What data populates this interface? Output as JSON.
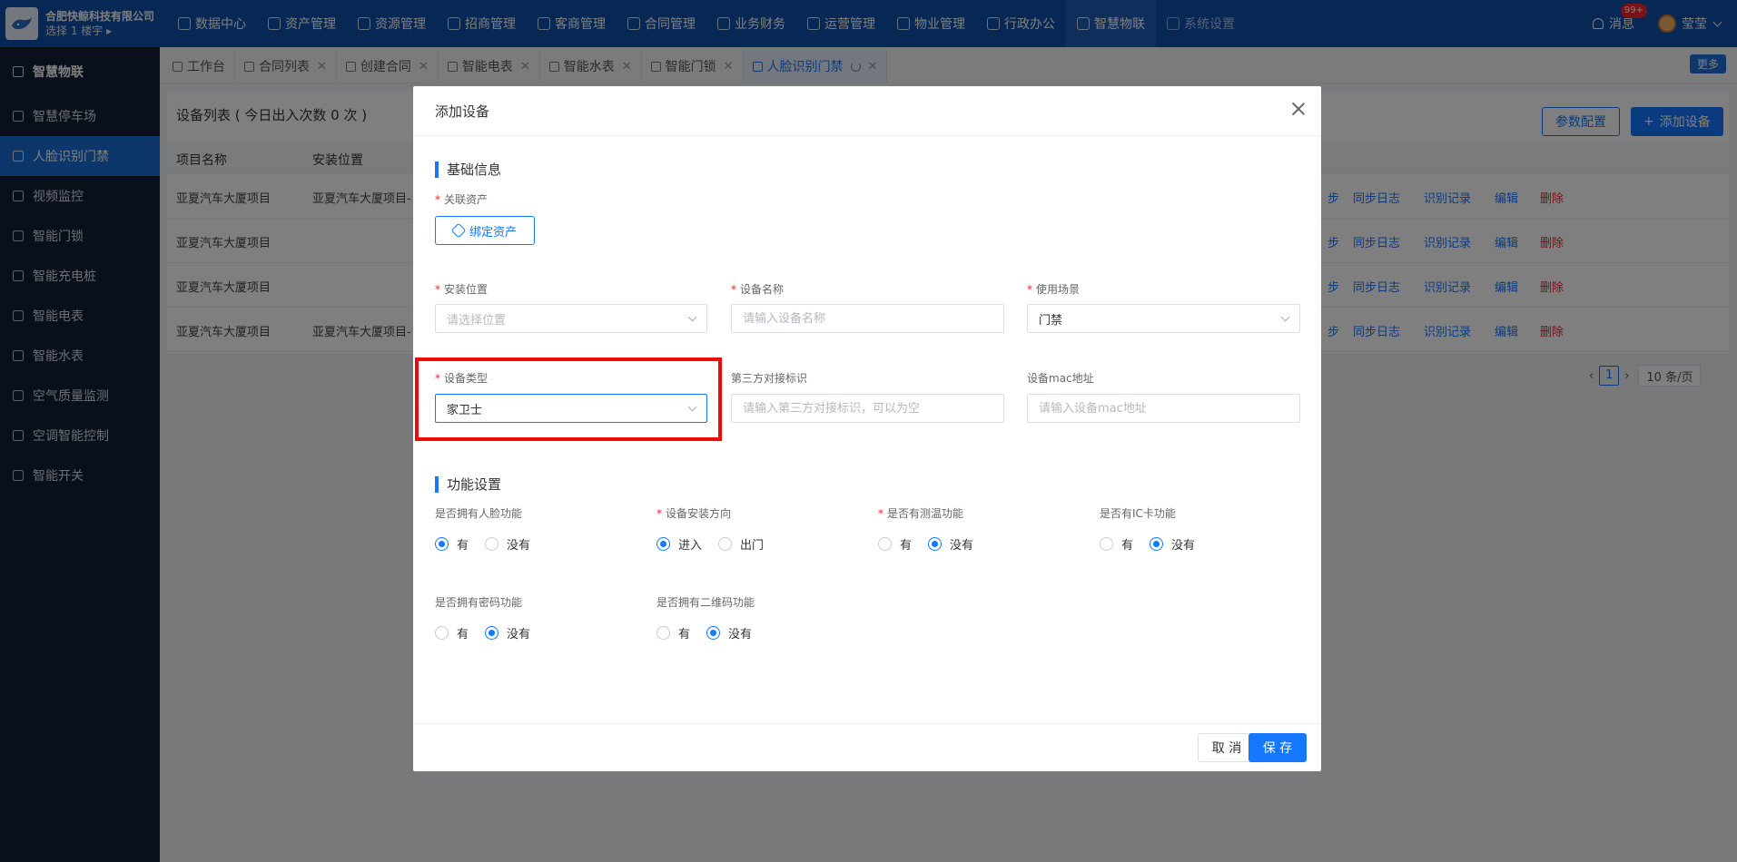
{
  "app": {
    "company": "合肥快鲸科技有限公司",
    "building_select": "选择 1 楼宇 ▸",
    "nav": [
      "数据中心",
      "资产管理",
      "资源管理",
      "招商管理",
      "客商管理",
      "合同管理",
      "业务财务",
      "运营管理",
      "物业管理",
      "行政办公",
      "智慧物联",
      "系统设置"
    ],
    "message_label": "消息",
    "message_badge": "99+",
    "user_name": "莹莹"
  },
  "sidebar": {
    "title": "智慧物联",
    "items": [
      "智慧停车场",
      "人脸识别门禁",
      "视频监控",
      "智能门锁",
      "智能充电桩",
      "智能电表",
      "智能水表",
      "空气质量监测",
      "空调智能控制",
      "智能开关"
    ]
  },
  "tabs": [
    "工作台",
    "合同列表",
    "创建合同",
    "智能电表",
    "智能水表",
    "智能门锁",
    "人脸识别门禁"
  ],
  "more_label": "更多",
  "list": {
    "title": "设备列表 ( 今日出入次数 0 次 )",
    "param_button": "参数配置",
    "add_button": "添加设备",
    "columns": [
      "项目名称",
      "安装位置"
    ],
    "rows": [
      {
        "project": "亚夏汽车大厦项目",
        "location": "亚夏汽车大厦项目-"
      },
      {
        "project": "亚夏汽车大厦项目",
        "location": ""
      },
      {
        "project": "亚夏汽车大厦项目",
        "location": ""
      },
      {
        "project": "亚夏汽车大厦项目",
        "location": "亚夏汽车大厦项目-"
      }
    ],
    "actions": [
      "步",
      "同步日志",
      "识别记录",
      "编辑",
      "删除"
    ],
    "page": "1",
    "page_size": "10 条/页"
  },
  "modal": {
    "title": "添加设备",
    "basic_section": "基础信息",
    "asset_label": "关联资产",
    "bind_button": "绑定资产",
    "location_label": "安装位置",
    "location_placeholder": "请选择位置",
    "name_label": "设备名称",
    "name_placeholder": "请输入设备名称",
    "scene_label": "使用场景",
    "scene_value": "门禁",
    "type_label": "设备类型",
    "type_value": "家卫士",
    "third_label": "第三方对接标识",
    "third_placeholder": "请输入第三方对接标识，可以为空",
    "mac_label": "设备mac地址",
    "mac_placeholder": "请输入设备mac地址",
    "func_section": "功能设置",
    "face_label": "是否拥有人脸功能",
    "direction_label": "设备安装方向",
    "temp_label": "是否有测温功能",
    "ic_label": "是否有IC卡功能",
    "password_label": "是否拥有密码功能",
    "qrcode_label": "是否拥有二维码功能",
    "opt_yes": "有",
    "opt_no": "没有",
    "opt_in": "进入",
    "opt_out": "出门",
    "cancel": "取 消",
    "save": "保 存"
  }
}
